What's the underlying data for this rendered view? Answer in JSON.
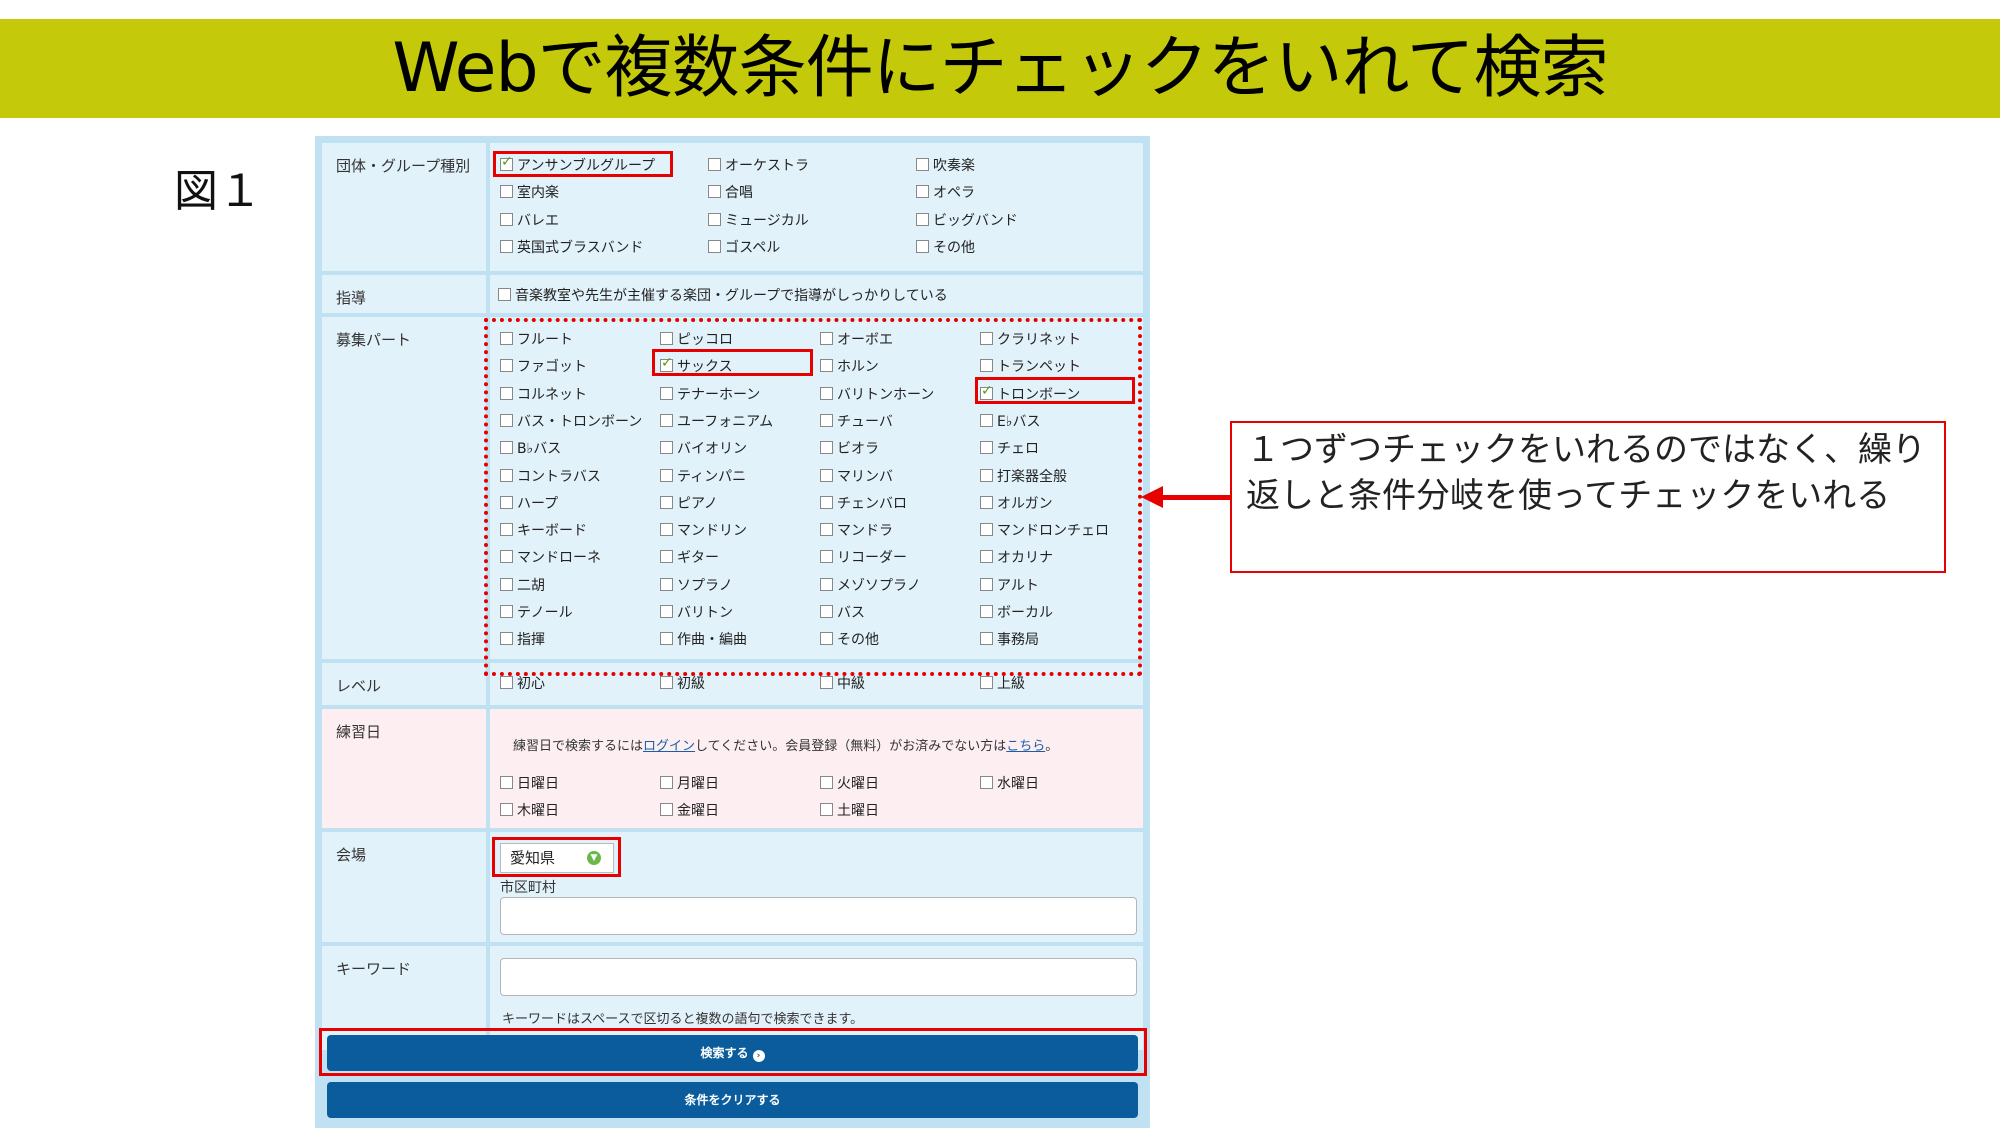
{
  "header": {
    "title": "Webで複数条件にチェックをいれて検索"
  },
  "figure_label": "図１",
  "form": {
    "type_label": "団体・グループ種別",
    "type_options": [
      {
        "label": "アンサンブルグループ",
        "checked": true
      },
      {
        "label": "オーケストラ",
        "checked": false
      },
      {
        "label": "吹奏楽",
        "checked": false
      },
      {
        "label": "室内楽",
        "checked": false
      },
      {
        "label": "合唱",
        "checked": false
      },
      {
        "label": "オペラ",
        "checked": false
      },
      {
        "label": "バレエ",
        "checked": false
      },
      {
        "label": "ミュージカル",
        "checked": false
      },
      {
        "label": "ビッグバンド",
        "checked": false
      },
      {
        "label": "英国式ブラスバンド",
        "checked": false
      },
      {
        "label": "ゴスペル",
        "checked": false
      },
      {
        "label": "その他",
        "checked": false
      }
    ],
    "guidance_label": "指導",
    "guidance_option": {
      "label": "音楽教室や先生が主催する楽団・グループで指導がしっかりしている",
      "checked": false
    },
    "parts_label": "募集パート",
    "parts_options": [
      {
        "label": "フルート",
        "checked": false
      },
      {
        "label": "ピッコロ",
        "checked": false
      },
      {
        "label": "オーボエ",
        "checked": false
      },
      {
        "label": "クラリネット",
        "checked": false
      },
      {
        "label": "ファゴット",
        "checked": false
      },
      {
        "label": "サックス",
        "checked": true
      },
      {
        "label": "ホルン",
        "checked": false
      },
      {
        "label": "トランペット",
        "checked": false
      },
      {
        "label": "コルネット",
        "checked": false
      },
      {
        "label": "テナーホーン",
        "checked": false
      },
      {
        "label": "バリトンホーン",
        "checked": false
      },
      {
        "label": "トロンボーン",
        "checked": true
      },
      {
        "label": "バス・トロンボーン",
        "checked": false
      },
      {
        "label": "ユーフォニアム",
        "checked": false
      },
      {
        "label": "チューバ",
        "checked": false
      },
      {
        "label": "E♭バス",
        "checked": false
      },
      {
        "label": "B♭バス",
        "checked": false
      },
      {
        "label": "バイオリン",
        "checked": false
      },
      {
        "label": "ビオラ",
        "checked": false
      },
      {
        "label": "チェロ",
        "checked": false
      },
      {
        "label": "コントラバス",
        "checked": false
      },
      {
        "label": "ティンパニ",
        "checked": false
      },
      {
        "label": "マリンバ",
        "checked": false
      },
      {
        "label": "打楽器全般",
        "checked": false
      },
      {
        "label": "ハープ",
        "checked": false
      },
      {
        "label": "ピアノ",
        "checked": false
      },
      {
        "label": "チェンバロ",
        "checked": false
      },
      {
        "label": "オルガン",
        "checked": false
      },
      {
        "label": "キーボード",
        "checked": false
      },
      {
        "label": "マンドリン",
        "checked": false
      },
      {
        "label": "マンドラ",
        "checked": false
      },
      {
        "label": "マンドロンチェロ",
        "checked": false
      },
      {
        "label": "マンドローネ",
        "checked": false
      },
      {
        "label": "ギター",
        "checked": false
      },
      {
        "label": "リコーダー",
        "checked": false
      },
      {
        "label": "オカリナ",
        "checked": false
      },
      {
        "label": "二胡",
        "checked": false
      },
      {
        "label": "ソプラノ",
        "checked": false
      },
      {
        "label": "メゾソプラノ",
        "checked": false
      },
      {
        "label": "アルト",
        "checked": false
      },
      {
        "label": "テノール",
        "checked": false
      },
      {
        "label": "バリトン",
        "checked": false
      },
      {
        "label": "バス",
        "checked": false
      },
      {
        "label": "ボーカル",
        "checked": false
      },
      {
        "label": "指揮",
        "checked": false
      },
      {
        "label": "作曲・編曲",
        "checked": false
      },
      {
        "label": "その他",
        "checked": false
      },
      {
        "label": "事務局",
        "checked": false
      }
    ],
    "level_label": "レベル",
    "level_options": [
      {
        "label": "初心",
        "checked": false
      },
      {
        "label": "初級",
        "checked": false
      },
      {
        "label": "中級",
        "checked": false
      },
      {
        "label": "上級",
        "checked": false
      }
    ],
    "practice_label": "練習日",
    "practice_note_before": "練習日で検索するには",
    "practice_login_link": "ログイン",
    "practice_note_middle": "してください。会員登録（無料）がお済みでない方は",
    "practice_here_link": "こちら",
    "practice_note_after": "。",
    "practice_options": [
      {
        "label": "日曜日",
        "checked": false
      },
      {
        "label": "月曜日",
        "checked": false
      },
      {
        "label": "火曜日",
        "checked": false
      },
      {
        "label": "水曜日",
        "checked": false
      },
      {
        "label": "木曜日",
        "checked": false
      },
      {
        "label": "金曜日",
        "checked": false
      },
      {
        "label": "土曜日",
        "checked": false
      }
    ],
    "venue_label": "会場",
    "venue_select_value": "愛知県",
    "city_label": "市区町村",
    "city_value": "",
    "keyword_label": "キーワード",
    "keyword_value": "",
    "keyword_help": "キーワードはスペースで区切ると複数の語句で検索できます。",
    "search_button": "検索する",
    "clear_button": "条件をクリアする"
  },
  "callout": {
    "text": "１つずつチェックをいれるのではなく、繰り返しと条件分岐を使ってチェックをいれる"
  },
  "colors": {
    "banner": "#c4c90a",
    "highlight": "#e60000",
    "button": "#0b5c9c",
    "form_border": "#bfe1f2"
  }
}
